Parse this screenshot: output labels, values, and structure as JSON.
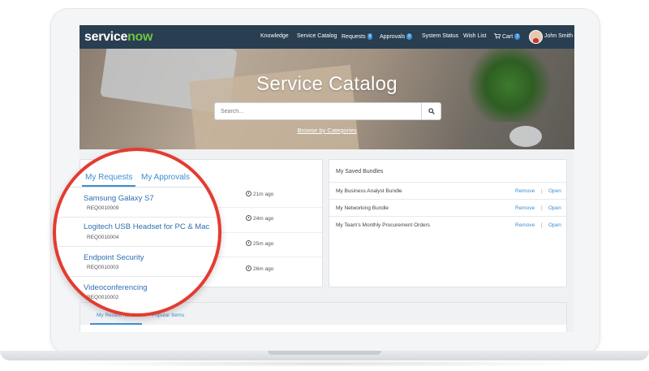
{
  "brand": {
    "service": "service",
    "now": "now",
    "accent": "#6fc242",
    "nav_bg": "#293e50",
    "link_color": "#3e8ed0",
    "circle_color": "#e53b30"
  },
  "nav": {
    "knowledge": "Knowledge",
    "catalog": "Service Catalog",
    "requests": "Requests",
    "requests_count": "9",
    "approvals": "Approvals",
    "approvals_count": "9",
    "status": "System Status",
    "wishlist": "Wish List",
    "cart": "Cart",
    "cart_count": "3",
    "user": "John Smith"
  },
  "hero": {
    "title": "Service Catalog",
    "search_placeholder": "Search...",
    "browse": "Browse by Categories"
  },
  "requests": {
    "tabs": [
      "My Requests",
      "My Approvals"
    ],
    "items": [
      {
        "title": "Samsung Galaxy S7",
        "number": "REQ0010009",
        "time": "21m ago"
      },
      {
        "title": "Logitech USB Headset for PC & Mac",
        "number": "REQ0010004",
        "time": "24m ago"
      },
      {
        "title": "Endpoint Security",
        "number": "REQ0010003",
        "time": "25m ago"
      },
      {
        "title": "Videoconferencing",
        "number": "REQ0010002",
        "time": "26m ago"
      }
    ]
  },
  "bundles": {
    "title": "My Saved Bundles",
    "remove": "Remove",
    "open": "Open",
    "separator": "|",
    "items": [
      "My Business Analyst Bundle",
      "My Networking Bundle",
      "My Team's Monthly Procurement Orders"
    ]
  },
  "bottom_tabs": [
    "My Recent Items",
    "Popular Items"
  ],
  "icons": {
    "search": "search-icon",
    "cart": "cart-icon",
    "clock": "clock-icon",
    "avatar": "user-avatar"
  }
}
